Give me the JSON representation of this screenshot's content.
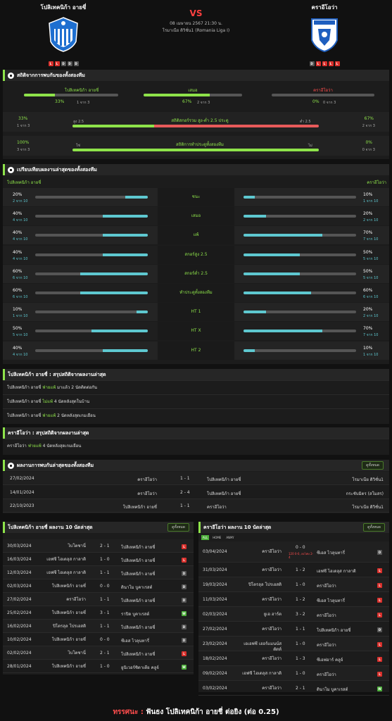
{
  "header": {
    "home_name": "โปลิเทคนิก้า อายชี่",
    "away_name": "คราอีโอว่า",
    "vs": "VS",
    "date": "08 เมษายน 2567 21:30 น.",
    "league": "โรมาเนีย ดิวิชั่น1 (Romania Liga I)",
    "home_form": [
      "L",
      "L",
      "D",
      "D",
      "D"
    ],
    "away_form": [
      "D",
      "L",
      "L",
      "L",
      "L"
    ]
  },
  "h2h_stats": {
    "title": "สถิติจากการพบกันของทั้งสองทีม",
    "home": {
      "label": "โปลิเทคนิก้า อายชี่",
      "pct": "33%",
      "sub": "1 จาก 3",
      "value": 0.33
    },
    "draw": {
      "label": "เสมอ",
      "pct": "67%",
      "sub": "2 จาก 3",
      "value": 0.67
    },
    "away": {
      "label": "คราอีโอว่า",
      "pct": "0%",
      "sub": "0 จาก 3",
      "value": 0
    },
    "goals": {
      "label": "สถิติสกอร์รวม สูง-ต่ำ 2.5 ประตู",
      "left_pct": "33%",
      "left_sub": "1 จาก 3",
      "left_tag": "สูง 2.5",
      "right_tag": "ต่ำ 2.5",
      "right_pct": "67%",
      "right_sub": "2 จาก 3",
      "value": 0.33
    },
    "btts": {
      "label": "สถิติการทำประตูทั้งสองทีม",
      "left_pct": "100%",
      "left_sub": "3 จาก 3",
      "left_tag": "ใช่",
      "right_tag": "ไม่",
      "right_pct": "0%",
      "right_sub": "0 จาก 3",
      "value": 1
    }
  },
  "compare": {
    "title": "เปรียบเทียบผลงานล่าสุดของทั้งสองทีม",
    "home": "โปลิเทคนิก้า อายชี่",
    "away": "คราอีโอว่า",
    "rows": [
      {
        "label": "ชนะ",
        "lp": "20%",
        "ls": "2 จาก 10",
        "lv": 0.2,
        "rp": "10%",
        "rs": "1 จาก 10",
        "rv": 0.1
      },
      {
        "label": "เสมอ",
        "lp": "40%",
        "ls": "4 จาก 10",
        "lv": 0.4,
        "rp": "20%",
        "rs": "2 จาก 10",
        "rv": 0.2
      },
      {
        "label": "แพ้",
        "lp": "40%",
        "ls": "4 จาก 10",
        "lv": 0.4,
        "rp": "70%",
        "rs": "7 จาก 10",
        "rv": 0.7
      },
      {
        "label": "สกอร์สูง 2.5",
        "lp": "40%",
        "ls": "4 จาก 10",
        "lv": 0.4,
        "rp": "50%",
        "rs": "5 จาก 10",
        "rv": 0.5
      },
      {
        "label": "สกอร์ต่ำ 2.5",
        "lp": "60%",
        "ls": "6 จาก 10",
        "lv": 0.6,
        "rp": "50%",
        "rs": "5 จาก 10",
        "rv": 0.5
      },
      {
        "label": "ทำประตูทั้งสองทีม",
        "lp": "60%",
        "ls": "6 จาก 10",
        "lv": 0.6,
        "rp": "60%",
        "rs": "6 จาก 10",
        "rv": 0.6
      },
      {
        "label": "HT 1",
        "lp": "10%",
        "ls": "1 จาก 10",
        "lv": 0.1,
        "rp": "20%",
        "rs": "2 จาก 10",
        "rv": 0.2
      },
      {
        "label": "HT X",
        "lp": "50%",
        "ls": "5 จาก 10",
        "lv": 0.5,
        "rp": "70%",
        "rs": "7 จาก 10",
        "rv": 0.7
      },
      {
        "label": "HT 2",
        "lp": "40%",
        "ls": "4 จาก 10",
        "lv": 0.4,
        "rp": "10%",
        "rs": "1 จาก 10",
        "rv": 0.1
      }
    ]
  },
  "summary_home": {
    "title": "โปลิเทคนิก้า อายชี่ : สรุปสถิติจากผลงานล่าสุด",
    "lines": [
      {
        "team": "โปลิเทคนิก้า อายชี่",
        "hl": "ฟ่ายแพ้",
        "rest": "มาแล้ว 2 นัดติดต่อกัน"
      },
      {
        "team": "โปลิเทคนิก้า อายชี่",
        "hl": "ไม่แพ้",
        "rest": "4 นัดหลังสุดในบ้าน"
      },
      {
        "team": "โปลิเทคนิก้า อายชี่",
        "hl": "ฟ่ายแพ้",
        "rest": "2 นัดหลังสุดเกมเยือน"
      }
    ]
  },
  "summary_away": {
    "title": "คราอีโอว่า : สรุปสถิติจากผลงานล่าสุด",
    "lines": [
      {
        "team": "คราอีโอว่า",
        "hl": "ฟ่ายแพ้",
        "rest": "4 นัดหลังสุดเกมเยือน"
      }
    ]
  },
  "h2h_results": {
    "title": "ผลงานการพบกันล่าสุดของทั้งสองทีม",
    "button": "ดูทั้งหมด",
    "rows": [
      {
        "date": "27/02/2024",
        "home": "คราอีโอว่า",
        "score": "1 - 1",
        "away": "โปลิเทคนิก้า อายชี่",
        "comp": "โรมาเนีย ดิวิชั่น1"
      },
      {
        "date": "14/01/2024",
        "home": "คราอีโอว่า",
        "score": "2 - 4",
        "away": "โปลิเทคนิก้า อายชี่",
        "comp": "กระชับมิตร (สโมสร)"
      },
      {
        "date": "22/10/2023",
        "home": "โปลิเทคนิก้า อายชี่",
        "score": "1 - 1",
        "away": "คราอีโอว่า",
        "comp": "โรมาเนีย ดิวิชั่น1"
      }
    ]
  },
  "last10_home": {
    "title": "โปลิเทคนิก้า อายชี่ ผลงาน 10 นัดล่าสุด",
    "button": "ดูทั้งหมด",
    "rows": [
      {
        "date": "30/03/2024",
        "home": "ไบโตซานี่",
        "score": "2 - 1",
        "away": "โปลิเทคนิก้า อายชี่",
        "res": "L"
      },
      {
        "date": "16/03/2024",
        "home": "เอฟซี ไฮเดลุส กาลาติ",
        "score": "1 - 0",
        "away": "โปลิเทคนิก้า อายชี่",
        "res": "L"
      },
      {
        "date": "12/03/2024",
        "home": "เอฟซี ไฮเดลุส กาลาติ",
        "score": "1 - 1",
        "away": "โปลิเทคนิก้า อายชี่",
        "res": "D"
      },
      {
        "date": "02/03/2024",
        "home": "โปลิเทคนิก้า อายชี่",
        "score": "0 - 0",
        "away": "ดินาโม บูคาเรสต์",
        "res": "D"
      },
      {
        "date": "27/02/2024",
        "home": "คราอีโอว่า",
        "score": "1 - 1",
        "away": "โปลิเทคนิก้า อายชี่",
        "res": "D"
      },
      {
        "date": "25/02/2024",
        "home": "โปลิเทคนิก้า อายชี่",
        "score": "3 - 1",
        "away": "ราปิด บูคาเรสต์",
        "res": "W"
      },
      {
        "date": "16/02/2024",
        "home": "ปิโตรลุล โปรเอสติ",
        "score": "1 - 1",
        "away": "โปลิเทคนิก้า อายชี่",
        "res": "D"
      },
      {
        "date": "10/02/2024",
        "home": "โปลิเทคนิก้า อายชี่",
        "score": "0 - 0",
        "away": "ซีเอส ไวลุนทารี่",
        "res": "D"
      },
      {
        "date": "02/02/2024",
        "home": "ไบโตซานี่",
        "score": "2 - 1",
        "away": "โปลิเทคนิก้า อายชี่",
        "res": "L"
      },
      {
        "date": "28/01/2024",
        "home": "โปลิเทคนิก้า อายชี่",
        "score": "1 - 0",
        "away": "ยูนิเวอร์ซิตาเตีย คลูจ์",
        "res": "W"
      }
    ]
  },
  "last10_away": {
    "title": "คราอีโอว่า ผลงาน 10 นัดล่าสุด",
    "button": "ดูทั้งหมด",
    "rows": [
      {
        "date": "03/04/2024",
        "home": "คราอีโอว่า",
        "score": "0 - 0",
        "away": "ซีเอส ไวลุนทารี่",
        "res": "D",
        "extra": "120 0-0, ลงโทษ 2-4"
      },
      {
        "date": "31/03/2024",
        "home": "คราอีโอว่า",
        "score": "1 - 2",
        "away": "เอฟซี ไฮเดลุส กาลาติ",
        "res": "L",
        "extra": ""
      },
      {
        "date": "19/03/2024",
        "home": "ปิโตรลุล โปรเอสติ",
        "score": "1 - 0",
        "away": "คราอีโอว่า",
        "res": "L",
        "extra": ""
      },
      {
        "date": "11/03/2024",
        "home": "คราอีโอว่า",
        "score": "1 - 2",
        "away": "ซีเอส ไวลุนทารี่",
        "res": "L",
        "extra": ""
      },
      {
        "date": "02/03/2024",
        "home": "ยูเอ ฮาร์ต",
        "score": "3 - 2",
        "away": "คราอีโอว่า",
        "res": "L",
        "extra": ""
      },
      {
        "date": "27/02/2024",
        "home": "คราอีโอว่า",
        "score": "1 - 1",
        "away": "โปลิเทคนิก้า อายชี่",
        "res": "D",
        "extra": ""
      },
      {
        "date": "23/02/2024",
        "home": "เอเอฟซี เฮอร์แมนน์สตัดท์",
        "score": "1 - 0",
        "away": "คราอีโอว่า",
        "res": "L",
        "extra": ""
      },
      {
        "date": "18/02/2024",
        "home": "คราอีโอว่า",
        "score": "1 - 3",
        "away": "ซีเอฟอาร์ คลูจ์",
        "res": "L",
        "extra": ""
      },
      {
        "date": "09/02/2024",
        "home": "เอฟซี ไฮเดลุส กาลาติ",
        "score": "1 - 0",
        "away": "คราอีโอว่า",
        "res": "L",
        "extra": ""
      },
      {
        "date": "03/02/2024",
        "home": "คราอีโอว่า",
        "score": "2 - 1",
        "away": "ดินาโม บูคาเรสต์",
        "res": "W",
        "extra": ""
      }
    ]
  },
  "tabs": [
    "ALL",
    "HOME",
    "AWAY"
  ],
  "footer": {
    "prefix": "ทรรศนะ :",
    "text": "ฟันธง โปลิเทคนิก้า อายชี่ ต่อยิง (ต่อ 0.25)"
  },
  "colors": {
    "accent": "#8ee34a",
    "teal": "#5ec8d0",
    "red": "#e85a5a",
    "loss": "#d9302c",
    "draw": "#555555",
    "win": "#4caf3a"
  }
}
